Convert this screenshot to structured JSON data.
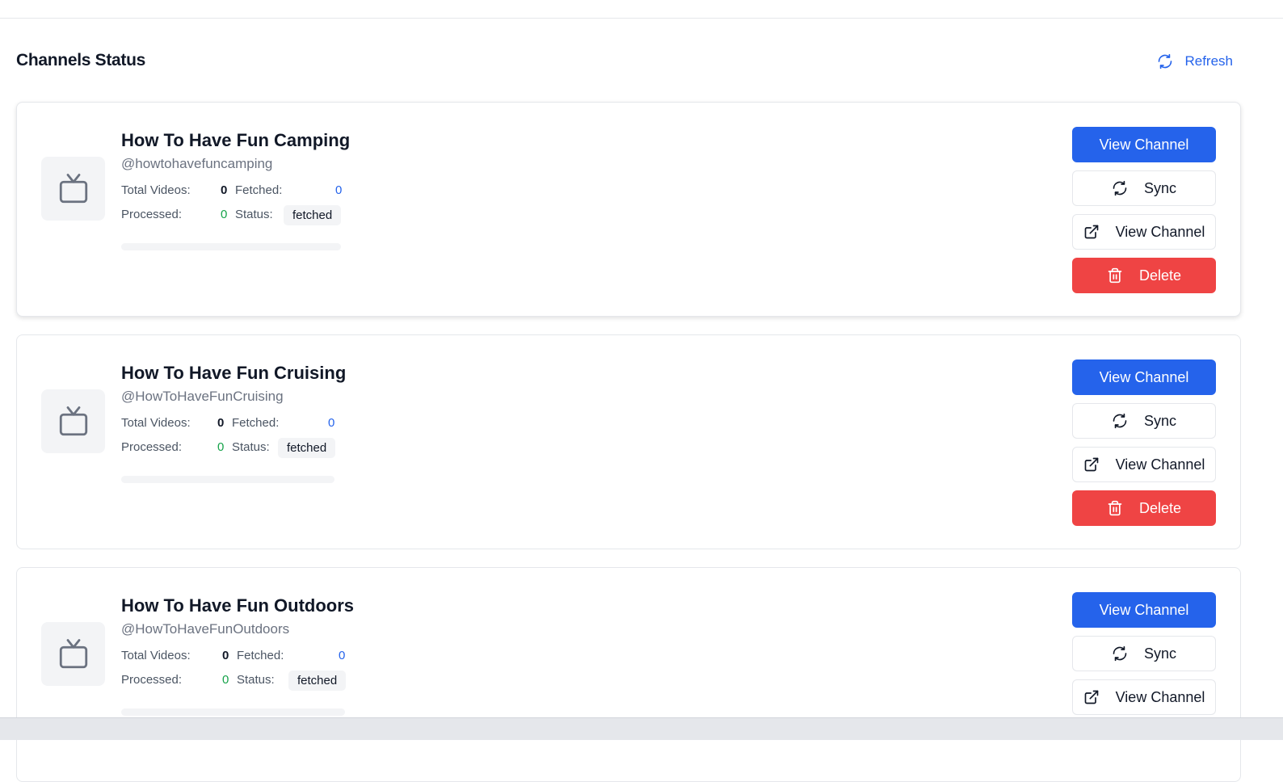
{
  "page": {
    "title": "Channels Status",
    "refresh_label": "Refresh",
    "accent_color": "#2563eb",
    "danger_color": "#ef4444"
  },
  "labels": {
    "total_videos": "Total Videos:",
    "fetched": "Fetched:",
    "processed": "Processed:",
    "status": "Status:"
  },
  "actions": {
    "view_channel": "View Channel",
    "sync": "Sync",
    "view_channel_external": "View Channel",
    "delete": "Delete"
  },
  "channels": [
    {
      "name": "How To Have Fun Camping",
      "handle": "@howtohavefuncamping",
      "total_videos": "0",
      "fetched": "0",
      "processed": "0",
      "status": "fetched",
      "progress": 0
    },
    {
      "name": "How To Have Fun Cruising",
      "handle": "@HowToHaveFunCruising",
      "total_videos": "0",
      "fetched": "0",
      "processed": "0",
      "status": "fetched",
      "progress": 0
    },
    {
      "name": "How To Have Fun Outdoors",
      "handle": "@HowToHaveFunOutdoors",
      "total_videos": "0",
      "fetched": "0",
      "processed": "0",
      "status": "fetched",
      "progress": 0
    }
  ],
  "icons": {
    "refresh": "refresh-icon",
    "tv": "tv-icon",
    "sync": "sync-icon",
    "external": "external-link-icon",
    "delete": "trash-icon"
  }
}
